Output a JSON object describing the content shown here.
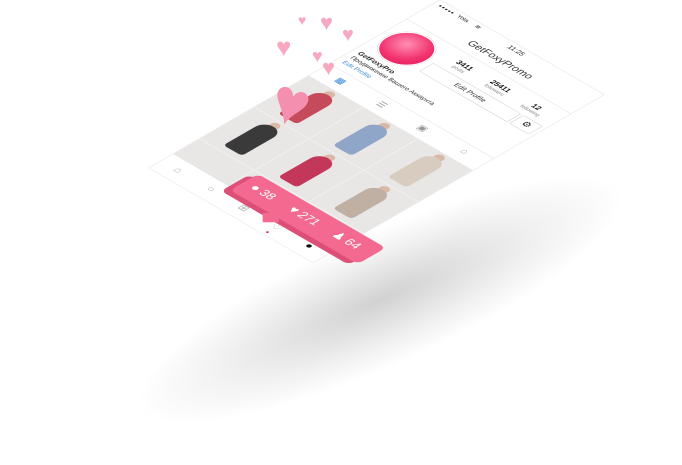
{
  "status_bar": {
    "carrier": "Yota",
    "wifi_icon": "wifi-icon",
    "time": "11:25"
  },
  "nav": {
    "title": "GetFoxyPromo"
  },
  "profile": {
    "posts": "3411",
    "posts_label": "posts",
    "followers": "25411",
    "followers_label": "followers",
    "following": "12",
    "following_label": "following",
    "edit_button": "Edit Profile",
    "settings_icon": "gear-icon",
    "username": "GetFoxyPro",
    "bio": "Продвижение Вашего Аккаунта",
    "edit_link": "Edit Profile"
  },
  "tabs": [
    {
      "icon": "grid-icon",
      "glyph": "▦"
    },
    {
      "icon": "list-icon",
      "glyph": "☰"
    },
    {
      "icon": "portrait-icon",
      "glyph": "▣"
    },
    {
      "icon": "bookmark-icon",
      "glyph": "⌂"
    }
  ],
  "tab_bar": [
    {
      "icon": "home-icon",
      "glyph": "⌂"
    },
    {
      "icon": "search-icon",
      "glyph": "○"
    },
    {
      "icon": "add-post-icon",
      "glyph": "⊞"
    },
    {
      "icon": "activity-heart-icon",
      "glyph": "♡"
    },
    {
      "icon": "profile-icon",
      "glyph": "●"
    }
  ],
  "notification": {
    "comments": "38",
    "comments_icon": "comment-icon",
    "likes": "271",
    "likes_icon": "heart-icon",
    "followers": "64",
    "followers_icon": "user-icon"
  },
  "colors": {
    "accent": "#f3698f",
    "link": "#3b8ad9",
    "avatar": "#f2336f"
  }
}
